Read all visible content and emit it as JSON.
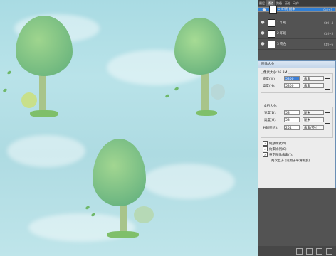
{
  "layers_panel": {
    "tabs": [
      "图层",
      "通道",
      "路径",
      "历史",
      "动作"
    ],
    "active_tab": 1,
    "layers": [
      {
        "name": "2 印刷 副本",
        "shortcut": "Ctrl+3",
        "selected": true
      },
      {
        "name": "1 印刷",
        "shortcut": "Ctrl+4",
        "selected": false
      },
      {
        "name": "2 印刷",
        "shortcut": "Ctrl+5",
        "selected": false
      },
      {
        "name": "3 专色",
        "shortcut": "Ctrl+6",
        "selected": false
      }
    ]
  },
  "dialog": {
    "title": "图像大小",
    "pixel_dims_label": "像素大小:26.8M",
    "width_label": "宽度(W):",
    "width_value": "5300",
    "height_label": "高度(H):",
    "height_value": "5300",
    "unit_pixel": "像素",
    "doc_size_label": "文档大小:",
    "doc_width_label": "宽度(D):",
    "doc_width_value": "53",
    "doc_height_label": "高度(G):",
    "doc_height_value": "53",
    "unit_cm": "厘米",
    "resolution_label": "分辨率(R):",
    "resolution_value": "254",
    "unit_res": "像素/英寸",
    "scale_styles": "缩放样式(Y)",
    "constrain": "约束比例(C)",
    "resample": "重定图像像素(I):",
    "method": "两次立方 (适用于平滑渐变)"
  }
}
